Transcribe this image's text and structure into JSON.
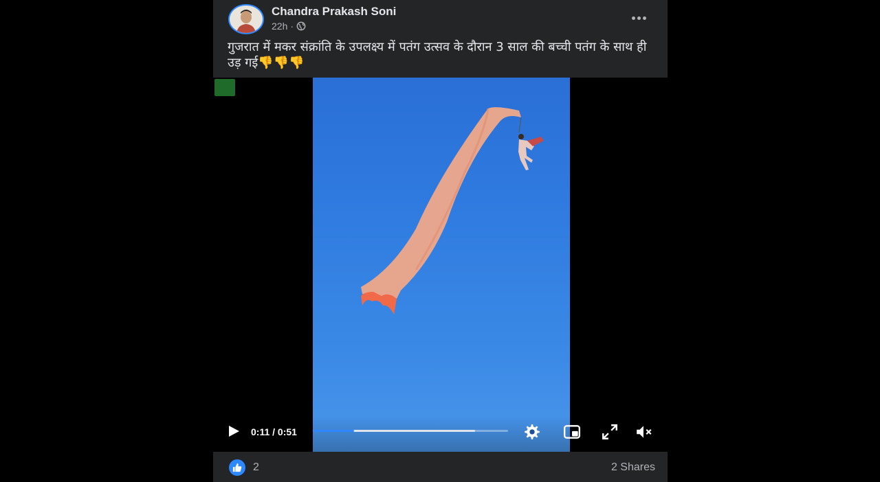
{
  "post": {
    "author": "Chandra Prakash Soni",
    "time": "22h",
    "caption": "गुजरात में मकर संक्रांति के उपलक्ष्य में पतंग उत्सव के दौरान 3 साल की बच्ची पतंग के साथ ही उड़ गई👎👎👎"
  },
  "video": {
    "time_display": "0:11 / 0:51",
    "progress_played": 0.21,
    "progress_buffered": 0.83
  },
  "reactions": {
    "like_count": "2",
    "shares": "2 Shares"
  },
  "colors": {
    "card_bg": "#242526",
    "accent": "#2d88ff",
    "sky": "#2f7be0",
    "kite": "#f0a889"
  },
  "icons": [
    "globe-icon",
    "more-icon",
    "play-icon",
    "settings-icon",
    "pip-icon",
    "fullscreen-icon",
    "mute-icon",
    "like-icon"
  ]
}
